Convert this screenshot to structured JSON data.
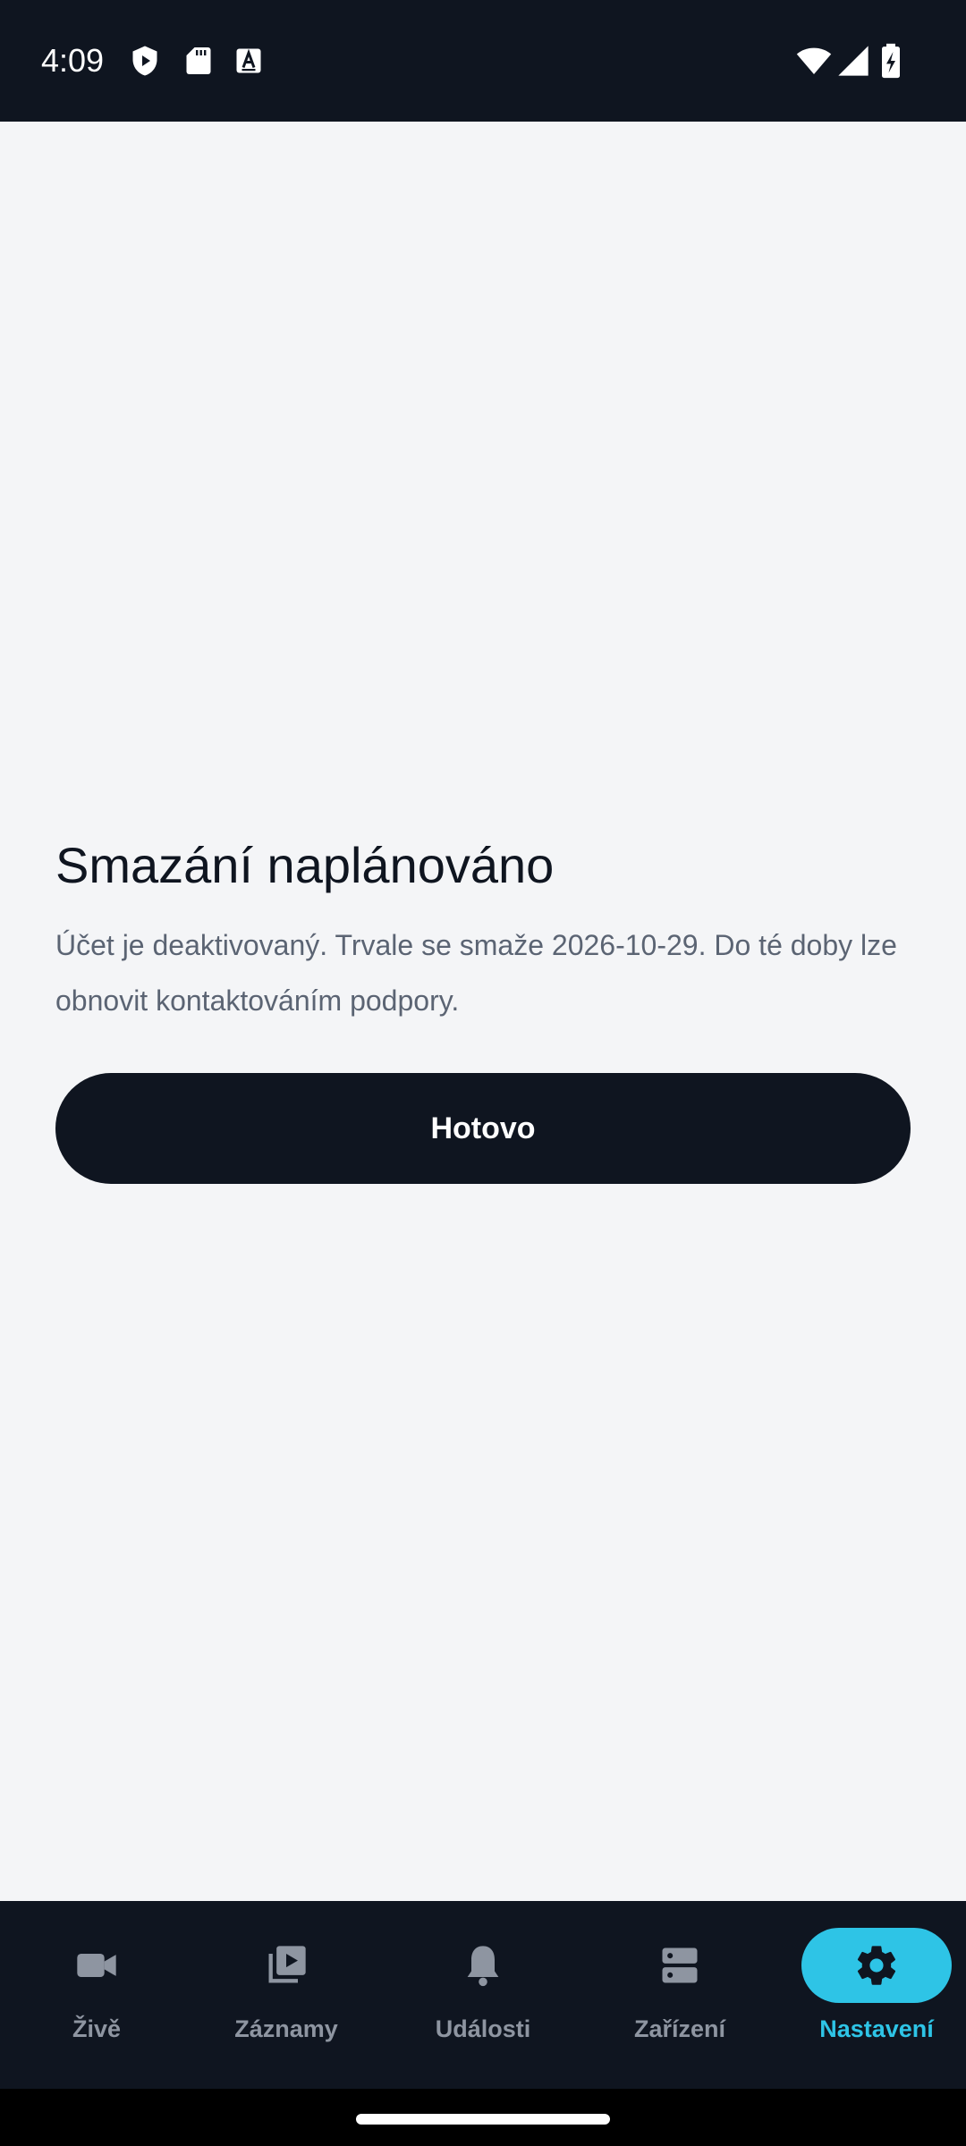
{
  "status_bar": {
    "time": "4:09",
    "left_icons": [
      "shield-play-icon",
      "sd-card-icon",
      "font-a-icon"
    ],
    "right_icons": [
      "wifi-icon",
      "cellular-signal-icon",
      "battery-charging-icon"
    ]
  },
  "dialog": {
    "title": "Smazání naplánováno",
    "message": "Účet je deaktivovaný. Trvale se smaže 2026-10-29. Do té doby lze obnovit kontaktováním podpory.",
    "done_label": "Hotovo"
  },
  "bottom_nav": {
    "items": [
      {
        "label": "Živě",
        "icon": "video-camera-icon",
        "active": false
      },
      {
        "label": "Záznamy",
        "icon": "playlist-play-icon",
        "active": false
      },
      {
        "label": "Události",
        "icon": "bell-icon",
        "active": false
      },
      {
        "label": "Zařízení",
        "icon": "server-icon",
        "active": false
      },
      {
        "label": "Nastavení",
        "icon": "gear-icon",
        "active": true
      }
    ]
  },
  "colors": {
    "background": "#f4f5f7",
    "dark": "#0f1520",
    "accent": "#2ec4e6",
    "muted_text": "#5b6473",
    "nav_inactive": "#8e95a1"
  }
}
